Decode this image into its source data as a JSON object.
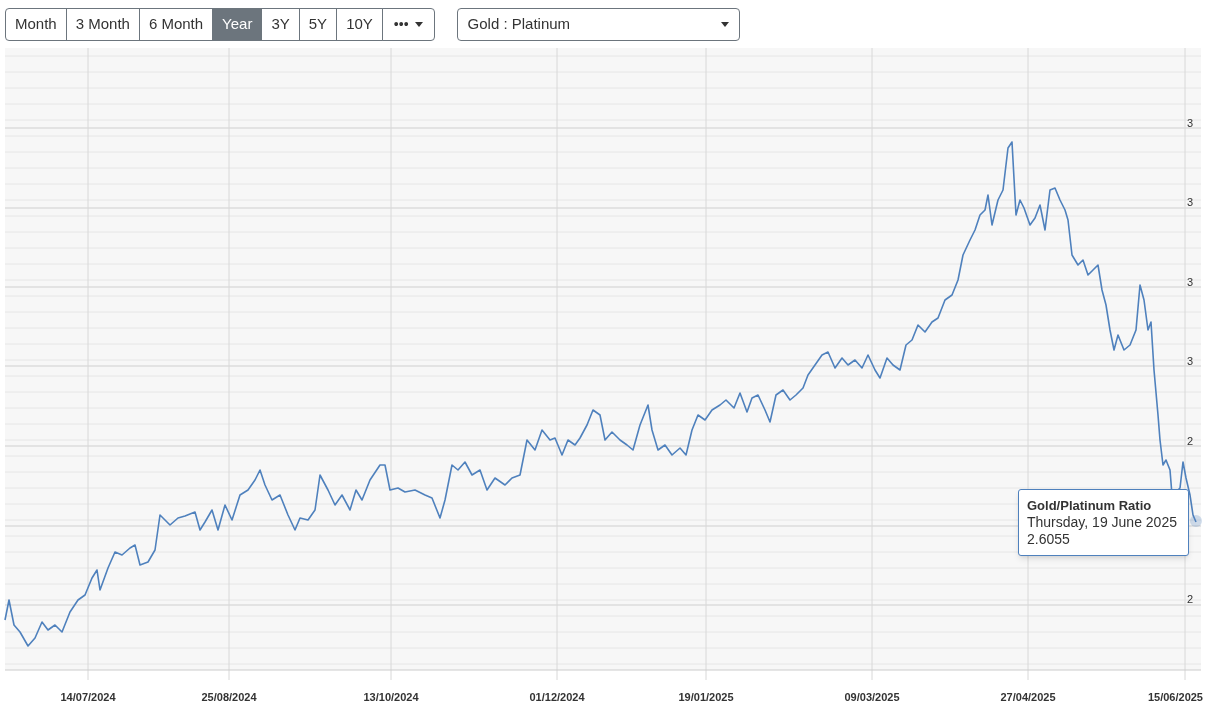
{
  "periods": [
    {
      "label": "Month",
      "selected": false
    },
    {
      "label": "3 Month",
      "selected": false
    },
    {
      "label": "6 Month",
      "selected": false
    },
    {
      "label": "Year",
      "selected": true
    },
    {
      "label": "3Y",
      "selected": false
    },
    {
      "label": "5Y",
      "selected": false
    },
    {
      "label": "10Y",
      "selected": false
    }
  ],
  "more_button": {
    "label": "•••"
  },
  "ratio_select": {
    "value": "Gold : Platinum"
  },
  "chart": {
    "y_labels": [
      "3",
      "3",
      "3",
      "3",
      "2",
      "2"
    ],
    "x_labels": [
      "14/07/2024",
      "25/08/2024",
      "13/10/2024",
      "01/12/2024",
      "19/01/2025",
      "09/03/2025",
      "27/04/2025",
      "15/06/2025"
    ],
    "tooltip": {
      "title": "Gold/Platinum Ratio",
      "date": "Thursday, 19 June 2025",
      "value": "2.6055"
    }
  }
}
